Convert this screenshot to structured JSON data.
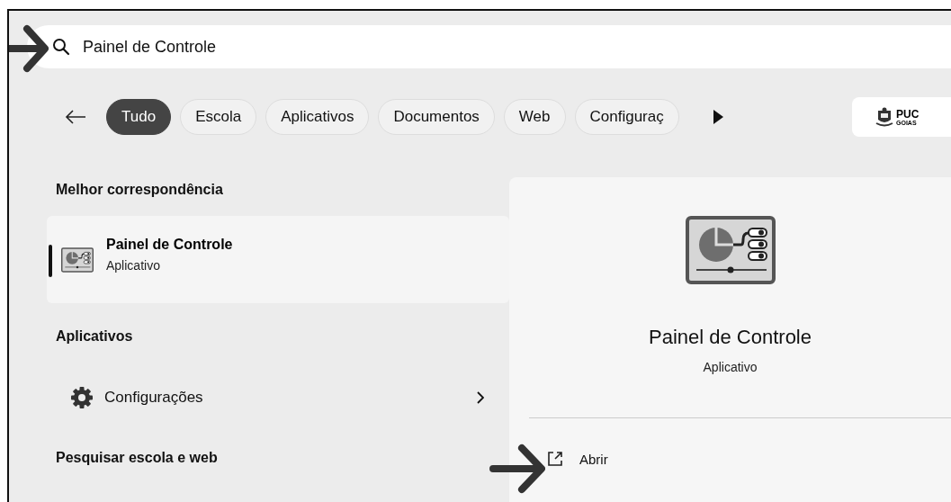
{
  "search": {
    "value": "Painel de Controle"
  },
  "filters": [
    {
      "label": "Tudo",
      "selected": true
    },
    {
      "label": "Escola",
      "selected": false
    },
    {
      "label": "Aplicativos",
      "selected": false
    },
    {
      "label": "Documentos",
      "selected": false
    },
    {
      "label": "Web",
      "selected": false
    },
    {
      "label": "Configuraç",
      "selected": false
    }
  ],
  "logo": {
    "line_1": "PUC",
    "line_2": "GOIAS"
  },
  "best_match": {
    "heading": "Melhor correspondência",
    "title": "Painel de Controle",
    "subtitle": "Aplicativo",
    "selected": true
  },
  "apps": {
    "heading": "Aplicativos",
    "items": [
      {
        "label": "Configurações"
      }
    ]
  },
  "web": {
    "heading": "Pesquisar escola e web"
  },
  "detail": {
    "title": "Painel de Controle",
    "subtitle": "Aplicativo",
    "actions": [
      {
        "label": "Abrir"
      }
    ]
  }
}
